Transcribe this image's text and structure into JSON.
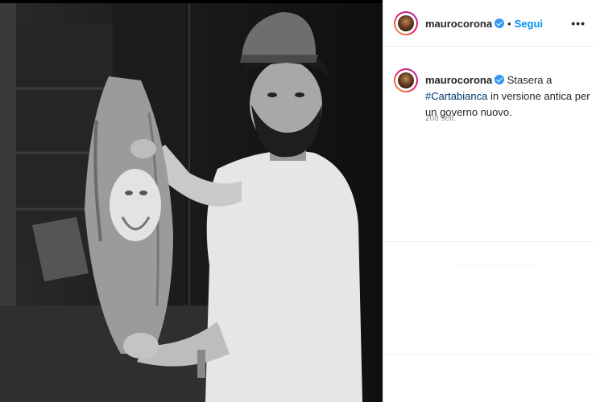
{
  "post": {
    "username": "maurocorona",
    "follow_label": "Segui",
    "dot": "•",
    "more_label": "•••"
  },
  "caption": {
    "username": "maurocorona",
    "text_before": "Stasera a ",
    "hashtag": "#Cartabianca",
    "text_after": "in versione antica per un governo nuovo."
  },
  "time_label": "208 sett.",
  "colors": {
    "link": "#0095f6",
    "verified": "#3897f0",
    "hashtag": "#00376b"
  }
}
